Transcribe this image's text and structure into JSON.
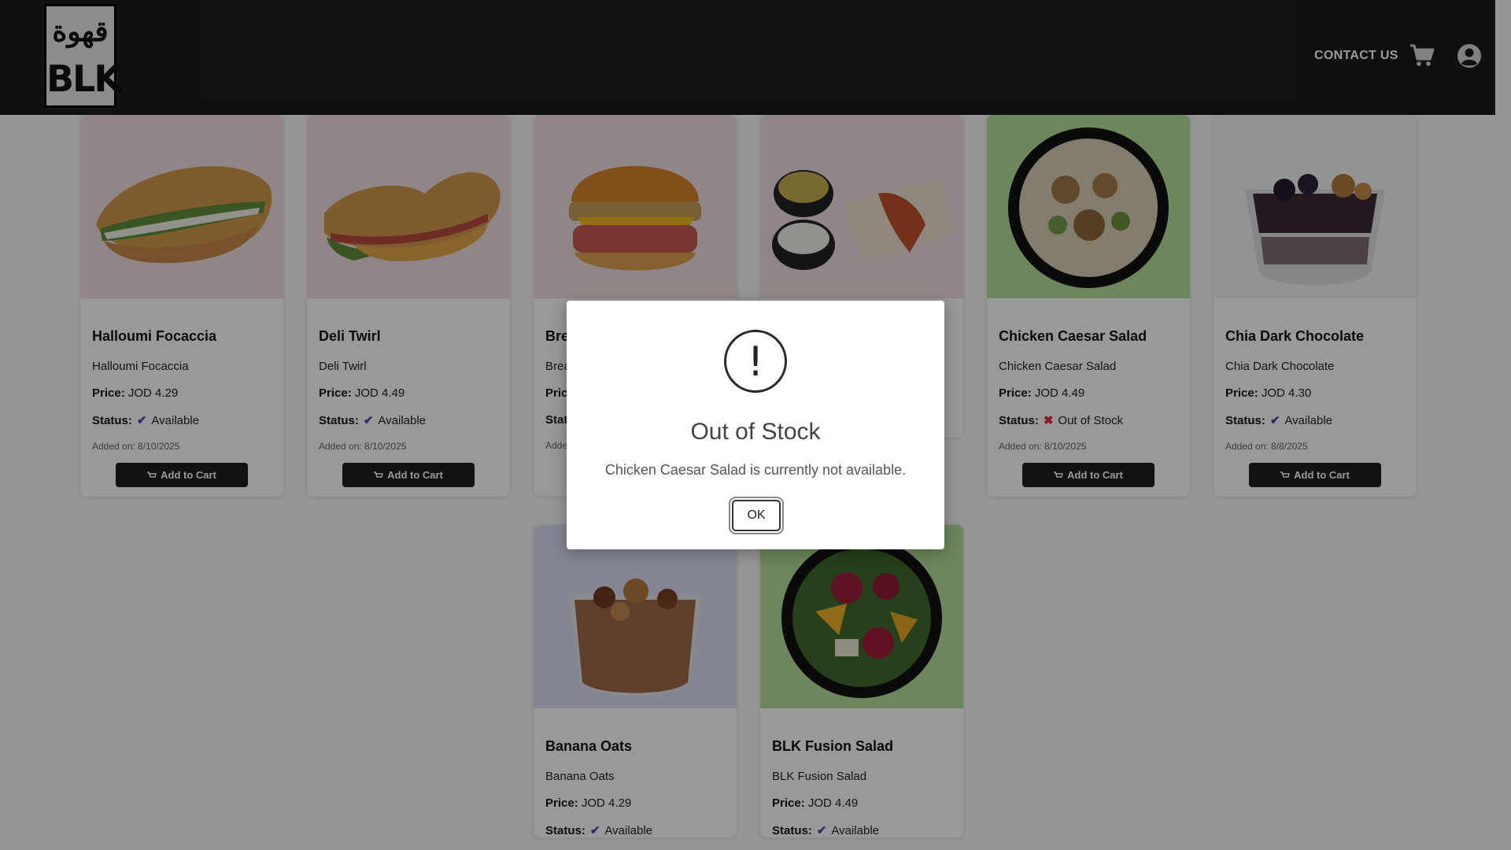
{
  "header": {
    "logo_arabic": "قهوة",
    "logo_text": "BLK",
    "contact_label": "CONTACT US",
    "cart_icon": "cart-icon",
    "user_icon": "user-account-icon"
  },
  "labels": {
    "price": "Price:",
    "status": "Status:",
    "add_to_cart": "Add to Cart"
  },
  "products": [
    {
      "name": "Halloumi Focaccia",
      "description": "Halloumi Focaccia",
      "price": "JOD 4.29",
      "status": "Available",
      "added": "Added on: 8/10/2025",
      "image_icon": "sandwich-image"
    },
    {
      "name": "Deli Twirl",
      "description": "Deli Twirl",
      "price": "JOD 4.49",
      "status": "Available",
      "added": "Added on: 8/10/2025",
      "image_icon": "sandwich-image"
    },
    {
      "name": "Bre",
      "description": "Brea",
      "price": "",
      "status": "",
      "added": "Adde",
      "image_icon": "burger-image"
    },
    {
      "name": "",
      "description": "",
      "price": "",
      "status": "",
      "added": "",
      "image_icon": "wrap-image"
    },
    {
      "name": "Chicken Caesar Salad",
      "description": "Chicken Caesar Salad",
      "price": "JOD 4.49",
      "status": "Out of Stock",
      "added": "Added on: 8/10/2025",
      "image_icon": "salad-bowl-image"
    },
    {
      "name": "Chia Dark Chocolate",
      "description": "Chia Dark Chocolate",
      "price": "JOD 4.30",
      "status": "Available",
      "added": "Added on: 8/8/2025",
      "image_icon": "dessert-cup-image"
    },
    {
      "name": "Banana Oats",
      "description": "Banana Oats",
      "price": "JOD 4.29",
      "status": "Available",
      "added": "",
      "image_icon": "oats-cup-image"
    },
    {
      "name": "BLK Fusion Salad",
      "description": "BLK Fusion Salad",
      "price": "JOD 4.49",
      "status": "Available",
      "added": "",
      "image_icon": "salad-bowl-image"
    }
  ],
  "dialog": {
    "icon": "exclamation-icon",
    "title": "Out of Stock",
    "message": "Chicken Caesar Salad is currently not available.",
    "ok_label": "OK"
  },
  "colors": {
    "header_bg": "#1c1c1c",
    "available_check": "#5a3fb0",
    "out_of_stock_x": "#e0263a",
    "button_bg": "#1f1f1f"
  }
}
